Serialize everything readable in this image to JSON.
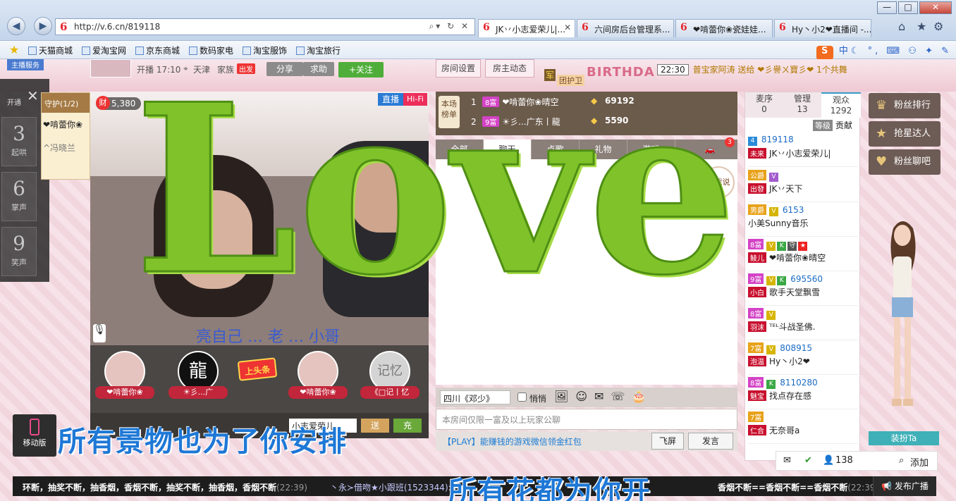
{
  "browser": {
    "url": "http://v.6.cn/819118",
    "tabs": [
      {
        "label": "JK丷小志爱荣儿|...",
        "active": true
      },
      {
        "label": "六间房后台管理系...",
        "active": false
      },
      {
        "label": "❤啃蕾你❀瓷娃娃...",
        "active": false
      },
      {
        "label": "Hy丶小2❤直播间 -...",
        "active": false
      }
    ],
    "favorites": [
      "天猫商城",
      "爱淘宝网",
      "京东商城",
      "数码家电",
      "淘宝服饰",
      "淘宝旅行"
    ],
    "ime": {
      "label": "S",
      "mode": "中"
    }
  },
  "topstrip": {
    "service": "主播服务",
    "live_time": "开播 17:10",
    "location": "天津",
    "family": "家族",
    "family_badge": "出发",
    "share": "分享",
    "request": "求助",
    "follow": "+关注",
    "room_settings": "房间设置",
    "host_news": "房主动态",
    "guard_group": "团护卫",
    "guard_badge": "军",
    "birthday": "BIRTHDA",
    "notice_time": "22:30",
    "notice_text": "普宝家阿涛 送给 ❤彡譽ㄨ寶彡❤ 1个共舞"
  },
  "sidepanel": {
    "open": "开通",
    "items": [
      {
        "num": "3",
        "label": "起哄"
      },
      {
        "num": "6",
        "label": "掌声"
      },
      {
        "num": "9",
        "label": "笑声"
      }
    ]
  },
  "guard": {
    "title": "守护(1/2)",
    "rows": [
      "❤啃蕾你❀",
      "^冯晓兰"
    ]
  },
  "video": {
    "live": "直播",
    "hifi": "Hi-Fi",
    "wealth_icon": "财",
    "wealth": "5,380",
    "caption": "亮自己 … 老 … 小哥"
  },
  "hosts": [
    {
      "name": "❤啃蕾你❀",
      "avatar": ""
    },
    {
      "name": "☀彡...广",
      "avatar": "龍"
    },
    {
      "name": "❤啃蕾你❀",
      "avatar": ""
    },
    {
      "name": "《□记丨忆",
      "avatar": "记忆"
    }
  ],
  "toutiao": "上头条",
  "giftbar": {
    "target": "小志爱荣儿",
    "send": "送",
    "more": "充"
  },
  "rank": {
    "label": "本场榜单",
    "rows": [
      {
        "rank": "1",
        "level": "8富",
        "name": "❤啃蕾你❀晴空",
        "value": "69192"
      },
      {
        "rank": "2",
        "level": "9富",
        "name": "☀彡...广东丨龍",
        "value": "5590"
      }
    ]
  },
  "chattabs": [
    "全部",
    "聊天",
    "点歌",
    "礼物",
    "游戏"
  ],
  "chat_badge": "3",
  "findme": "对我说",
  "chattool": {
    "to": "四川《邓少》",
    "whisper": "悄悄"
  },
  "chatinput": {
    "placeholder": "本房间仅限一富及以上玩家公聊"
  },
  "chatbottom": {
    "play": "【PLAY】能赚钱的游戏微信领金红包",
    "fly": "飞屏",
    "send": "发言"
  },
  "users": {
    "tabs": [
      {
        "label": "麦序",
        "count": "0"
      },
      {
        "label": "管理",
        "count": "13"
      },
      {
        "label": "观众",
        "count": "1292"
      }
    ],
    "cols": {
      "level": "等级",
      "contrib": "贡献"
    },
    "list": [
      {
        "tags": "4",
        "id": "819118",
        "badge": "未来",
        "name": "JK丷小志爱荣儿|"
      },
      {
        "tags": "公爵",
        "id": "",
        "badge": "出發",
        "name": "JK丷天下"
      },
      {
        "tags": "男爵",
        "id": "6153",
        "badge": "",
        "name": "小美Sunny音乐"
      },
      {
        "tags": "8富",
        "id": "",
        "badge": "鲮儿",
        "name": "❤啃蕾你❀晴空"
      },
      {
        "tags": "9富",
        "id": "695560",
        "badge": "小白",
        "name": "歌手天堂飘雪"
      },
      {
        "tags": "8富",
        "id": "",
        "badge": "羽沫",
        "name": "ᵀᴱᴸ斗战圣佛."
      },
      {
        "tags": "7富",
        "id": "808915",
        "badge": "泡温",
        "name": "Hy丶小2❤"
      },
      {
        "tags": "8富",
        "id": "8110280",
        "badge": "魅宝",
        "name": "找点存在感"
      },
      {
        "tags": "7富",
        "id": "",
        "badge": "仁合",
        "name": "无奈哥a"
      }
    ]
  },
  "userbottom": {
    "count": "138",
    "add": "添加"
  },
  "rightpanel": {
    "items": [
      "粉丝排行",
      "抢星达人",
      "粉丝聊吧"
    ],
    "dressup": "装扮Ta"
  },
  "mobile": "移动版",
  "bottombar": {
    "ticker1": "环断，抽奖不断，抽香烟，香烟不断，抽奖不断，抽香烟，香烟不断",
    "ticker1_time": "(22:39)",
    "ticker2": "丶永≻借吻★小跟班(1523344):",
    "ticker3": "香烟不断==香烟不断==香烟不断",
    "ticker3_time": "(22:39)",
    "broadcast": "发布广播"
  },
  "lyrics": {
    "line1": "所有景物也为了你安排",
    "line2": "所有花都为你开"
  },
  "overlay": {
    "love": "Love"
  }
}
